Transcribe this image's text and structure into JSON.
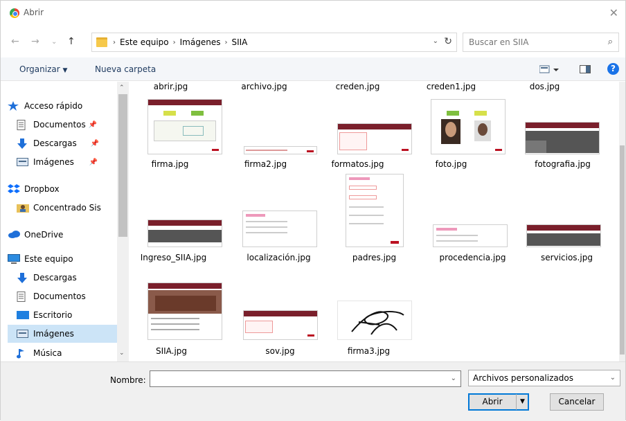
{
  "window": {
    "title": "Abrir"
  },
  "address": {
    "crumbs": [
      "Este equipo",
      "Imágenes",
      "SIIA"
    ]
  },
  "search": {
    "placeholder": "Buscar en SIIA"
  },
  "toolbar": {
    "organize": "Organizar",
    "new_folder": "Nueva carpeta"
  },
  "sidebar": {
    "items": [
      {
        "label": "Acceso rápido",
        "icon": "star-icon"
      },
      {
        "label": "Documentos",
        "icon": "documents-icon",
        "pinned": true
      },
      {
        "label": "Descargas",
        "icon": "download-icon",
        "pinned": true
      },
      {
        "label": "Imágenes",
        "icon": "pictures-icon",
        "pinned": true
      },
      {
        "label": "Dropbox",
        "icon": "dropbox-icon"
      },
      {
        "label": "Concentrado Sis",
        "icon": "user-folder-icon"
      },
      {
        "label": "OneDrive",
        "icon": "cloud-icon"
      },
      {
        "label": "Este equipo",
        "icon": "computer-icon"
      },
      {
        "label": "Descargas",
        "icon": "download-icon"
      },
      {
        "label": "Documentos",
        "icon": "documents-icon"
      },
      {
        "label": "Escritorio",
        "icon": "desktop-icon"
      },
      {
        "label": "Imágenes",
        "icon": "pictures-icon",
        "selected": true
      },
      {
        "label": "Música",
        "icon": "music-icon"
      }
    ]
  },
  "files": [
    {
      "name": "abrir.jpg"
    },
    {
      "name": "archivo.jpg"
    },
    {
      "name": "creden.jpg"
    },
    {
      "name": "creden1.jpg"
    },
    {
      "name": "dos.jpg"
    },
    {
      "name": "firma.jpg"
    },
    {
      "name": "firma2.jpg"
    },
    {
      "name": "formatos.jpg"
    },
    {
      "name": "foto.jpg"
    },
    {
      "name": "fotografia.jpg"
    },
    {
      "name": "Ingreso_SIIA.jpg"
    },
    {
      "name": "localización.jpg"
    },
    {
      "name": "padres.jpg"
    },
    {
      "name": "procedencia.jpg"
    },
    {
      "name": "servicios.jpg"
    },
    {
      "name": "SIIA.jpg"
    },
    {
      "name": "sov.jpg"
    },
    {
      "name": "firma3.jpg"
    }
  ],
  "bottom": {
    "name_label": "Nombre:",
    "name_value": "",
    "filter": "Archivos personalizados",
    "open": "Abrir",
    "cancel": "Cancelar"
  },
  "colors": {
    "accent": "#0078d7",
    "selected": "#cce4f7",
    "brand_maroon": "#7a1f2b"
  }
}
